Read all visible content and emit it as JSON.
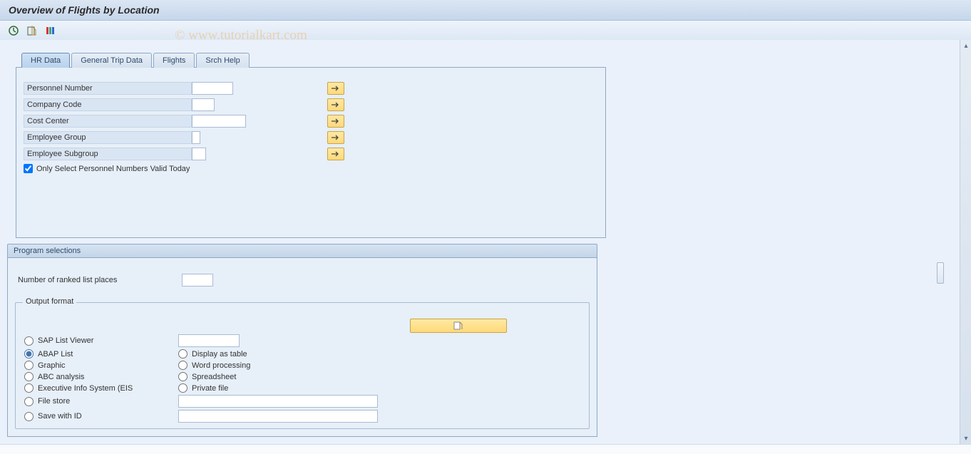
{
  "title": "Overview of Flights by Location",
  "watermark": "© www.tutorialkart.com",
  "tabs": {
    "hr_data": "HR Data",
    "general_trip": "General Trip Data",
    "flights": "Flights",
    "srch_help": "Srch Help"
  },
  "fields": {
    "personnel_number": {
      "label": "Personnel Number",
      "value": ""
    },
    "company_code": {
      "label": "Company Code",
      "value": ""
    },
    "cost_center": {
      "label": "Cost Center",
      "value": ""
    },
    "employee_group": {
      "label": "Employee Group",
      "value": ""
    },
    "employee_subgroup": {
      "label": "Employee Subgroup",
      "value": ""
    },
    "only_valid_today": {
      "label": "Only Select Personnel Numbers Valid Today",
      "checked": true
    }
  },
  "program_selections": {
    "title": "Program selections",
    "ranked_places": {
      "label": "Number of ranked list places",
      "value": ""
    }
  },
  "output_format": {
    "title": "Output format",
    "sap_list_viewer": {
      "label": "SAP List Viewer",
      "value": ""
    },
    "abap_list": {
      "label": "ABAP List"
    },
    "graphic": {
      "label": "Graphic"
    },
    "abc_analysis": {
      "label": "ABC analysis"
    },
    "eis": {
      "label": "Executive Info System (EIS"
    },
    "file_store": {
      "label": "File store",
      "value": ""
    },
    "save_with_id": {
      "label": "Save with ID",
      "value": ""
    },
    "display_as_table": {
      "label": "Display as table"
    },
    "word_processing": {
      "label": "Word processing"
    },
    "spreadsheet": {
      "label": "Spreadsheet"
    },
    "private_file": {
      "label": "Private file"
    },
    "selected": "abap_list"
  }
}
